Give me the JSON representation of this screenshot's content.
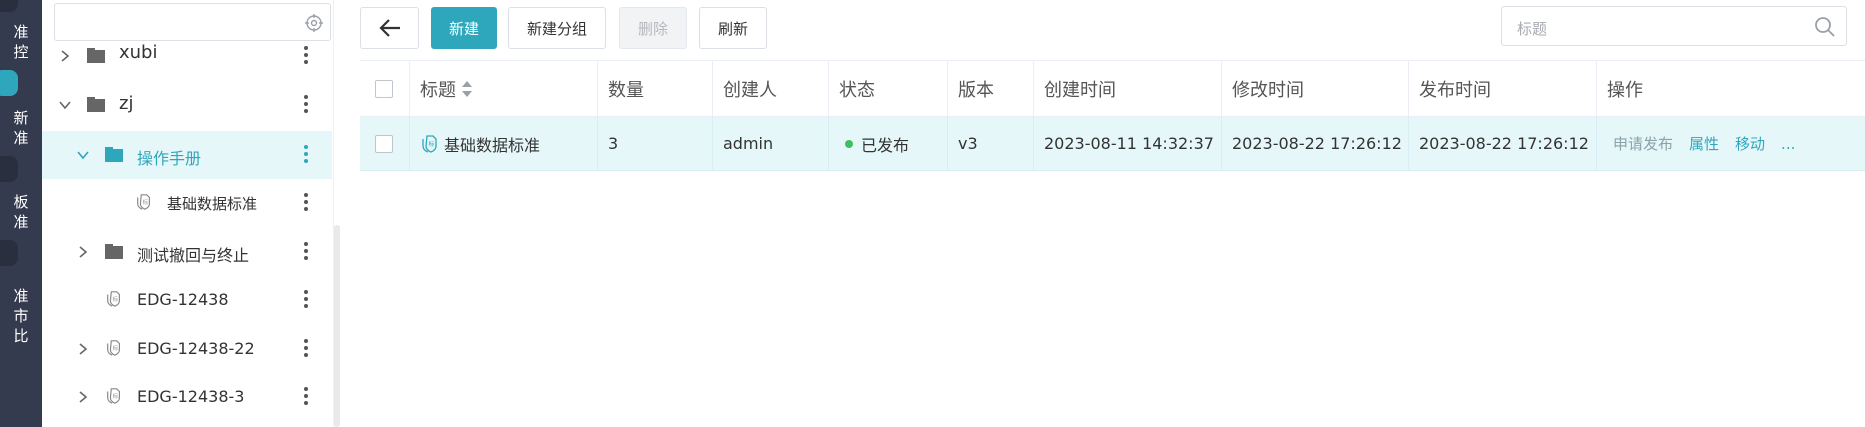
{
  "rail": {
    "items": [
      {
        "text": "准\n控"
      },
      {
        "text": "新\n准"
      },
      {
        "text": "板\n准"
      },
      {
        "text": "准\n市\n比"
      }
    ]
  },
  "tree": {
    "search": {
      "placeholder": ""
    },
    "nodes": [
      {
        "label": "xubi",
        "type": "folder",
        "expandable": true,
        "expanded": false,
        "selected": false,
        "depth": 1
      },
      {
        "label": "zj",
        "type": "folder",
        "expandable": true,
        "expanded": true,
        "selected": false,
        "depth": 1
      },
      {
        "label": "操作手册",
        "type": "folder",
        "expandable": true,
        "expanded": true,
        "selected": true,
        "depth": 2
      },
      {
        "label": "基础数据标准",
        "type": "standard",
        "expandable": false,
        "expanded": false,
        "selected": false,
        "depth": 3
      },
      {
        "label": "测试撤回与终止",
        "type": "folder",
        "expandable": true,
        "expanded": false,
        "selected": false,
        "depth": 2
      },
      {
        "label": "EDG-12438",
        "type": "standard",
        "expandable": false,
        "expanded": false,
        "selected": false,
        "depth": 2
      },
      {
        "label": "EDG-12438-22",
        "type": "standard",
        "expandable": true,
        "expanded": false,
        "selected": false,
        "depth": 2
      },
      {
        "label": "EDG-12438-3",
        "type": "standard",
        "expandable": true,
        "expanded": false,
        "selected": false,
        "depth": 2
      }
    ]
  },
  "toolbar": {
    "back": "back-arrow",
    "new_label": "新建",
    "new_group_label": "新建分组",
    "delete_label": "删除",
    "refresh_label": "刷新",
    "search_placeholder": "标题"
  },
  "table": {
    "headers": {
      "title": "标题",
      "count": "数量",
      "creator": "创建人",
      "status": "状态",
      "version": "版本",
      "created": "创建时间",
      "modified": "修改时间",
      "published": "发布时间",
      "actions": "操作"
    },
    "rows": [
      {
        "title": "基础数据标准",
        "count": "3",
        "creator": "admin",
        "status": "已发布",
        "version": "v3",
        "created": "2023-08-11 14:32:37",
        "modified": "2023-08-22 17:26:12",
        "published": "2023-08-22 17:26:12",
        "actions": {
          "apply": "申请发布",
          "props": "属性",
          "move": "移动",
          "more": "..."
        }
      }
    ]
  },
  "colors": {
    "accent": "#2ea7bd",
    "rail": "#353b4f",
    "selected_bg": "#e6f7f9",
    "status_dot": "#3fbf5f"
  }
}
